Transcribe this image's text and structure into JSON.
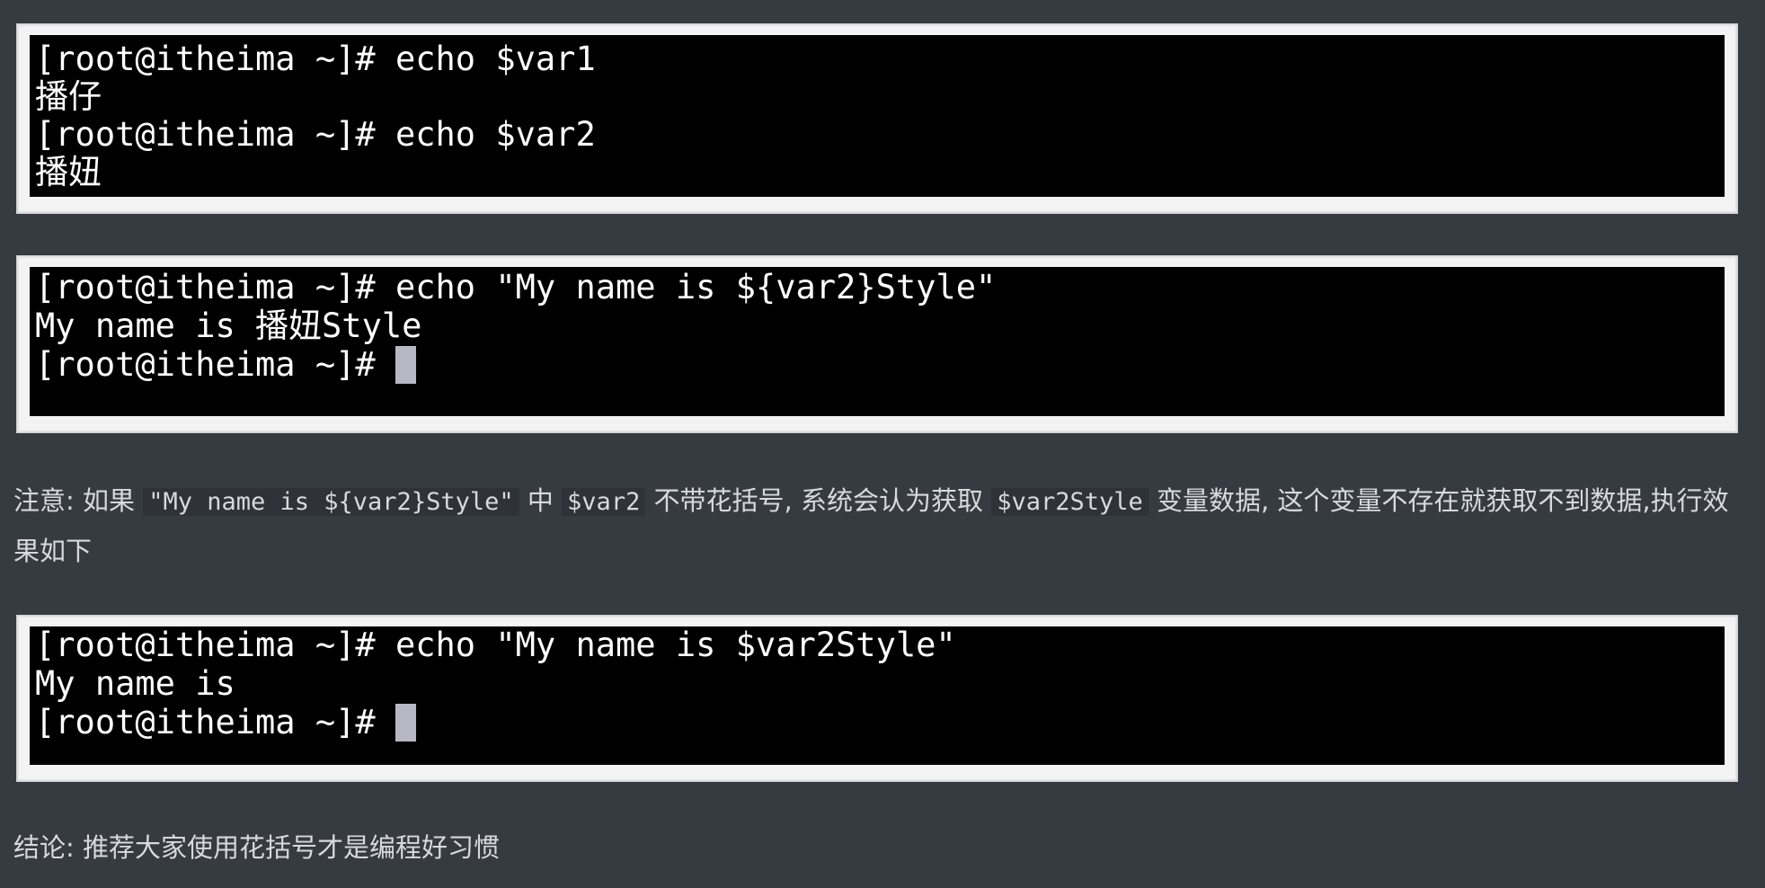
{
  "terminal1": {
    "lines": [
      "[root@itheima ~]# echo $var1",
      "播仔",
      "[root@itheima ~]# echo $var2",
      "播妞"
    ]
  },
  "terminal2": {
    "lines": [
      "[root@itheima ~]# echo \"My name is ${var2}Style\"",
      "My name is 播妞Style",
      "[root@itheima ~]# "
    ]
  },
  "note": {
    "prefix": "注意: 如果 ",
    "code1": "\"My name is ${var2}Style\"",
    "mid1": " 中 ",
    "code2": "$var2",
    "mid2": " 不带花括号, 系统会认为获取 ",
    "code3": "$var2Style",
    "suffix": " 变量数据, 这个变量不存在就获取不到数据,执行效果如下"
  },
  "terminal3": {
    "lines": [
      "[root@itheima ~]# echo \"My name is $var2Style\"",
      "My name is",
      "[root@itheima ~]# "
    ]
  },
  "conclusion": {
    "text": "结论:  推荐大家使用花括号才是编程好习惯"
  }
}
